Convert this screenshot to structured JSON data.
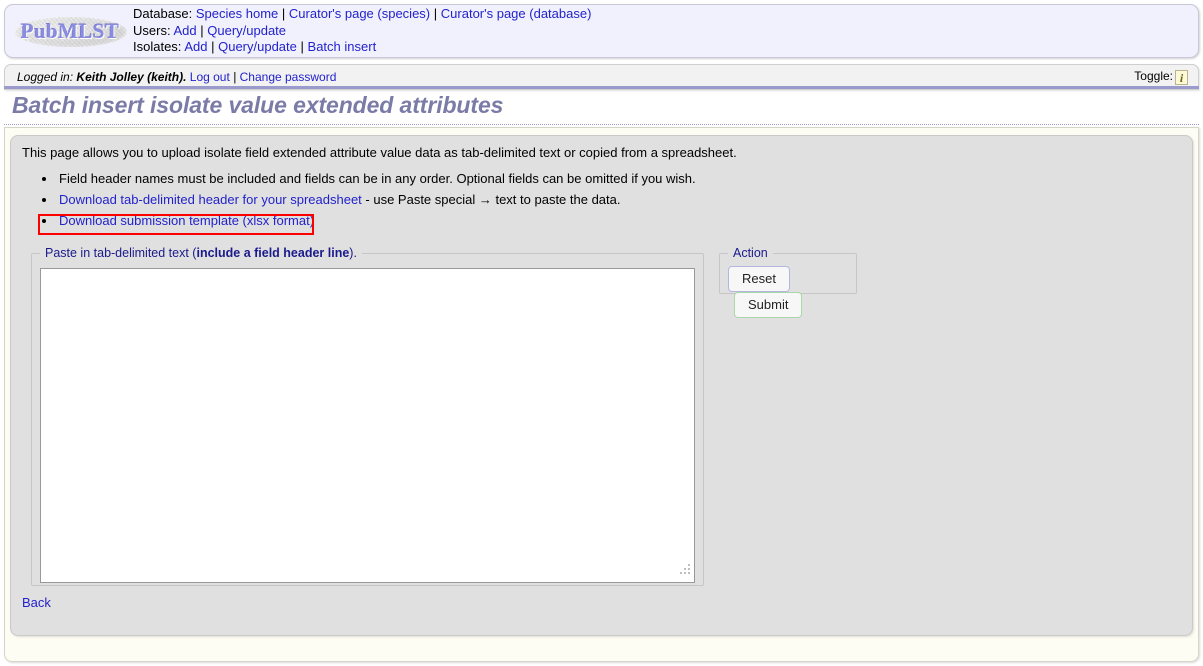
{
  "header": {
    "logo_text": "PubMLST",
    "nav": [
      {
        "label": "Database:",
        "links": [
          "Species home",
          "Curator's page (species)",
          "Curator's page (database)"
        ]
      },
      {
        "label": "Users:",
        "links": [
          "Add",
          "Query/update"
        ]
      },
      {
        "label": "Isolates:",
        "links": [
          "Add",
          "Query/update",
          "Batch insert"
        ]
      }
    ],
    "separator": "|"
  },
  "login_bar": {
    "prefix": "Logged in:",
    "user": "Keith Jolley (keith).",
    "logout_label": "Log out",
    "separator": "|",
    "change_password_label": "Change password",
    "toggle_label": "Toggle:",
    "toggle_icon": "info-icon",
    "toggle_icon_glyph": "i"
  },
  "page": {
    "title": "Batch insert isolate value extended attributes",
    "intro": "This page allows you to upload isolate field extended attribute value data as tab-delimited text or copied from a spreadsheet.",
    "bullets": [
      {
        "type": "text",
        "text": "Field header names must be included and fields can be in any order. Optional fields can be omitted if you wish."
      },
      {
        "type": "link_plus_text",
        "link": "Download tab-delimited header for your spreadsheet",
        "tail": " - use Paste special → text to paste the data."
      },
      {
        "type": "link",
        "link": "Download submission template (xlsx format)",
        "highlighted": true
      }
    ],
    "back_label": "Back"
  },
  "paste_fieldset": {
    "legend_prefix": "Paste in tab-delimited text (",
    "legend_bold": "include a field header line",
    "legend_suffix": ").",
    "textarea_value": "",
    "textarea_placeholder": ""
  },
  "action_fieldset": {
    "legend": "Action",
    "reset_label": "Reset",
    "submit_label": "Submit"
  },
  "colors": {
    "header_bg": "#f1f1fd",
    "link": "#2222cc",
    "title": "#7b7ba8",
    "purple_rule": "#9a9acd",
    "content_bg": "#e0e0e0",
    "highlight_box": "#ff0000",
    "legend_text": "#1a1a8c",
    "reset_border": "#b3b7e0",
    "submit_border": "#aad7a8",
    "toggle_bg": "#fdf8d8"
  }
}
